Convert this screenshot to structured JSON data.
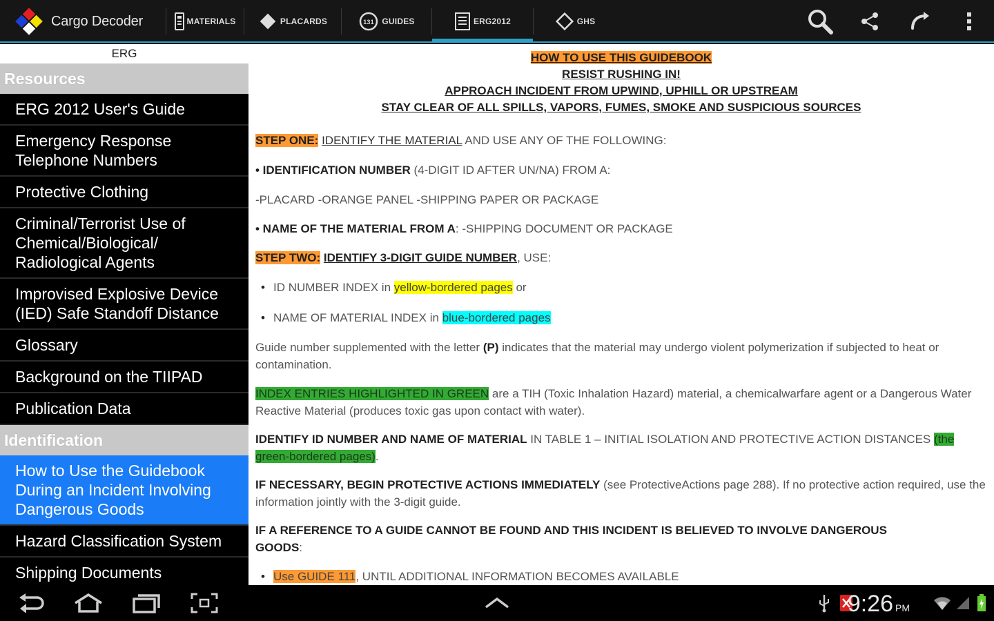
{
  "app": {
    "title": "Cargo Decoder"
  },
  "tabs": [
    {
      "label": "MATERIALS",
      "icon": "id-card-icon"
    },
    {
      "label": "PLACARDS",
      "icon": "diamond-icon"
    },
    {
      "label": "GUIDES",
      "icon": "badge-icon"
    },
    {
      "label": "ERG2012",
      "icon": "book-icon",
      "active": true
    },
    {
      "label": "GHS",
      "icon": "diamond-outline-icon"
    }
  ],
  "actions": [
    "search-icon",
    "share-icon",
    "undo-icon",
    "overflow-menu-icon"
  ],
  "sidebar": {
    "header": "ERG",
    "sections": [
      {
        "title": "Resources",
        "items": [
          "ERG 2012 User's Guide",
          "Emergency Response Telephone Numbers",
          "Protective Clothing",
          "Criminal/Terrorist Use of Chemical/Biological/ Radiological Agents",
          "Improvised Explosive Device (IED) Safe Standoff Distance",
          "Glossary",
          "Background on the TIIPAD",
          "Publication Data"
        ]
      },
      {
        "title": "Identification",
        "items": [
          "How to Use the Guidebook During an Incident Involving Dangerous Goods",
          "Hazard Classification System",
          "Shipping Documents"
        ]
      }
    ],
    "active_item": "How to Use the Guidebook During an Incident Involving Dangerous Goods"
  },
  "content": {
    "title": "HOW TO USE THIS GUIDEBOOK",
    "subtitle1": "RESIST RUSHING IN!",
    "subtitle2": "APPROACH INCIDENT FROM UPWIND, UPHILL OR UPSTREAM",
    "subtitle3": "STAY CLEAR OF ALL SPILLS, VAPORS, FUMES, SMOKE AND SUSPICIOUS SOURCES",
    "step1_label": "STEP ONE:",
    "step1_link": "IDENTIFY THE MATERIAL",
    "step1_rest": " AND USE ANY OF THE FOLLOWING:",
    "id_number_bold": "• IDENTIFICATION NUMBER",
    "id_number_rest": " (4-DIGIT ID AFTER UN/NA) FROM A:",
    "placard_line": "-PLACARD -ORANGE PANEL -SHIPPING PAPER OR PACKAGE",
    "name_bold": "• NAME OF THE MATERIAL FROM A",
    "name_rest": ": -SHIPPING DOCUMENT OR PACKAGE",
    "step2_label": "STEP TWO:",
    "step2_link": "IDENTIFY 3-DIGIT GUIDE NUMBER",
    "step2_rest": ", USE:",
    "bullet1_pre": "ID NUMBER INDEX in ",
    "bullet1_hl": "yellow-bordered pages",
    "bullet1_post": " or",
    "bullet2_pre": "NAME OF MATERIAL INDEX in ",
    "bullet2_hl": "blue-bordered pages",
    "poly_pre": "Guide number supplemented with the letter ",
    "poly_bold": "(P)",
    "poly_post": " indicates that the material may undergo violent polymerization if subjected to heat or contamination.",
    "green_hl": "INDEX ENTRIES HIGHLIGHTED IN GREEN",
    "green_post": " are a TIH (Toxic Inhalation Hazard) material, a chemicalwarfare agent or a Dangerous Water Reactive Material (produces toxic gas upon contact with water).",
    "table1_bold": "IDENTIFY ID NUMBER AND NAME OF MATERIAL",
    "table1_rest": " IN TABLE 1 – INITIAL ISOLATION AND PROTECTIVE ACTION DISTANCES ",
    "table1_hl": "(the green-bordered pages)",
    "table1_end": ".",
    "protective_bold": "IF NECESSARY, BEGIN PROTECTIVE ACTIONS IMMEDIATELY",
    "protective_rest": " (see ProtectiveActions page 288). If no protective action required, use the information jointly with the 3-digit guide.",
    "reference_bold": "IF A REFERENCE TO A GUIDE CANNOT BE FOUND AND THIS INCIDENT IS BELIEVED TO INVOLVE DANGEROUS",
    "reference_bold2": "GOODS",
    "reference_end": ":",
    "guide111_hl": "Use GUIDE 111",
    "guide111_rest": ", UNTIL ADDITIONAL INFORMATION BECOMES AVAILABLE"
  },
  "status": {
    "time": "9:26",
    "ampm": "PM"
  },
  "colors": {
    "accent": "#2f9fc7",
    "active_item": "#1a7cf7",
    "orange": "#ff9933",
    "yellow": "#ffff00",
    "cyan": "#00ffff",
    "green": "#33aa33"
  }
}
